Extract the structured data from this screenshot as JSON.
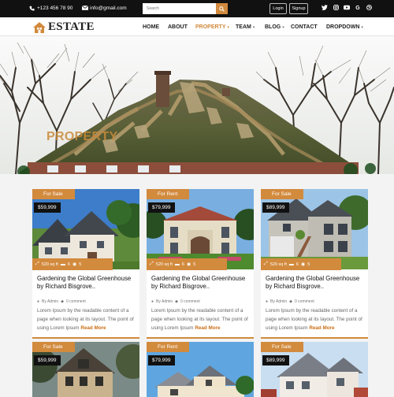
{
  "topbar": {
    "phone": "+123 456 78 90",
    "email": "info@gmail.com",
    "search_placeholder": "Search",
    "login": "Login",
    "signup": "Signup",
    "social": [
      "twitter-icon",
      "instagram-icon",
      "youtube-icon",
      "google-icon",
      "dribbble-icon"
    ]
  },
  "nav": {
    "logo": "ESTATE",
    "items": [
      "HOME",
      "ABOUT",
      "PROPERTY",
      "TEAM",
      "BLOG",
      "CONTACT",
      "DROPDOWN"
    ],
    "active": "PROPERTY"
  },
  "hero": {
    "title": "PROPERTY"
  },
  "colors": {
    "accent": "#d28a3d",
    "dark": "#111111"
  },
  "cards": [
    {
      "tag": "For Sale",
      "price": "$59,999",
      "area": "520 sq ft",
      "beds": "6",
      "baths": "5",
      "title": "Gardening the Global Greenhouse by Richard Bisgrove..",
      "author": "By Admin",
      "comments": "0 comment",
      "desc": "Lorem Ipsum by the readable content of a page when looking at its layout. The point of using Lorem Ipsum",
      "more": "Read More"
    },
    {
      "tag": "For Rent",
      "price": "$79,999",
      "area": "520 sq ft",
      "beds": "6",
      "baths": "5",
      "title": "Gardening the Global Greenhouse by Richard Bisgrove..",
      "author": "By Admin",
      "comments": "0 comment",
      "desc": "Lorem Ipsum by the readable content of a page when looking at its layout. The point of using Lorem Ipsum",
      "more": "Read More"
    },
    {
      "tag": "For Sale",
      "price": "$89,999",
      "area": "520 sq ft",
      "beds": "6",
      "baths": "5",
      "title": "Gardening the Global Greenhouse by Richard Bisgrove..",
      "author": "By Admin",
      "comments": "0 comment",
      "desc": "Lorem Ipsum by the readable content of a page when looking at its layout. The point of using Lorem Ipsum",
      "more": "Read More"
    },
    {
      "tag": "For Sale",
      "price": "$59,999"
    },
    {
      "tag": "For Rent",
      "price": "$79,999"
    },
    {
      "tag": "For Sale",
      "price": "$89,999"
    }
  ]
}
